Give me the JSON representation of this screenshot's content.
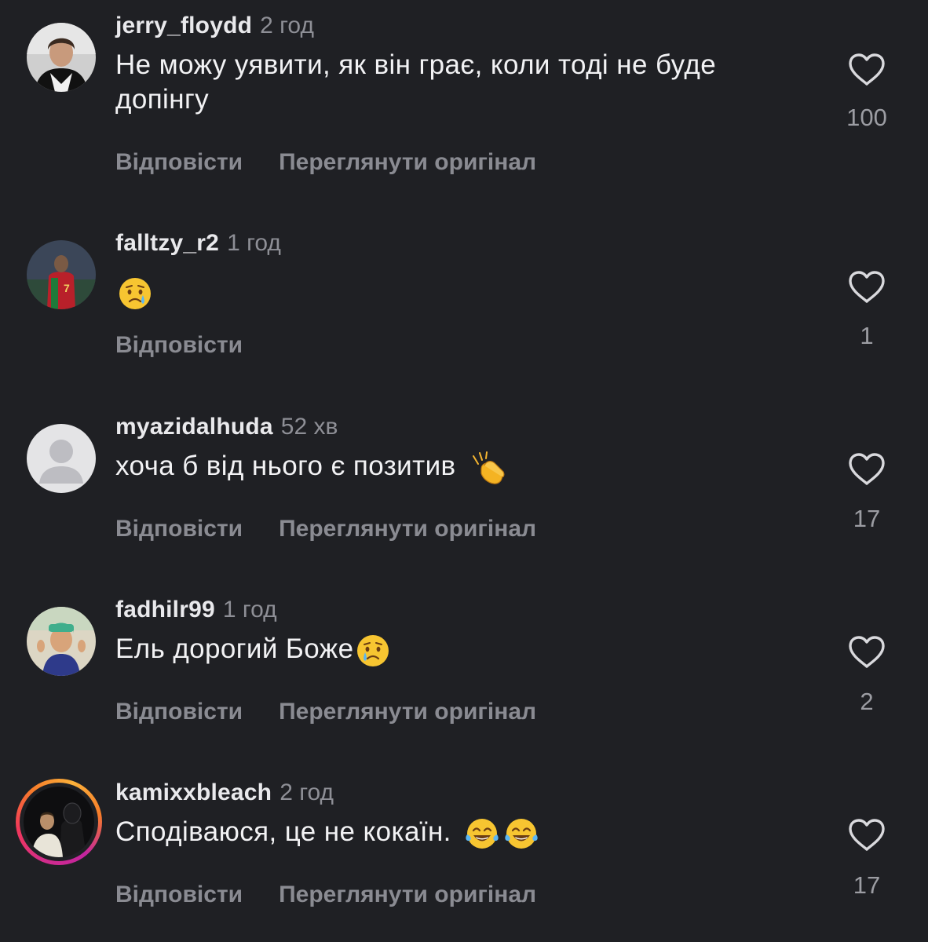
{
  "comments": [
    {
      "username": "jerry_floydd",
      "time": "2 год",
      "text": "Не можу уявити, як він грає, коли тоді не буде допінгу",
      "emoji": [],
      "reply_label": "Відповісти",
      "original_label": "Переглянути оригінал",
      "likes": "100",
      "avatar": "portrait-photo"
    },
    {
      "username": "falltzy_r2",
      "time": "1 год",
      "text": "",
      "emoji": [
        "crying-face-emoji"
      ],
      "reply_label": "Відповісти",
      "original_label": "",
      "likes": "1",
      "avatar": "football-player-photo"
    },
    {
      "username": "myazidalhuda",
      "time": "52 хв",
      "text": "хоча б від нього є позитив",
      "emoji": [
        "clapping-hands-emoji"
      ],
      "reply_label": "Відповісти",
      "original_label": "Переглянути оригінал",
      "likes": "17",
      "avatar": "default-avatar"
    },
    {
      "username": "fadhilr99",
      "time": "1 год",
      "text": "Ель дорогий Боже",
      "emoji": [
        "crying-face-emoji"
      ],
      "reply_label": "Відповісти",
      "original_label": "Переглянути оригінал",
      "likes": "2",
      "avatar": "child-photo"
    },
    {
      "username": "kamixxbleach",
      "time": "2 год",
      "text": "Сподіваюся, це не кокаїн.",
      "emoji": [
        "tears-of-joy-emoji",
        "tears-of-joy-emoji"
      ],
      "reply_label": "Відповісти",
      "original_label": "Переглянути оригінал",
      "likes": "17",
      "avatar": "story-ring-photo"
    }
  ],
  "colors": {
    "background": "#1f2024",
    "primary_text": "#f2f2f4",
    "secondary_text": "#8a8b92",
    "story_ring": "#d12c8c"
  }
}
